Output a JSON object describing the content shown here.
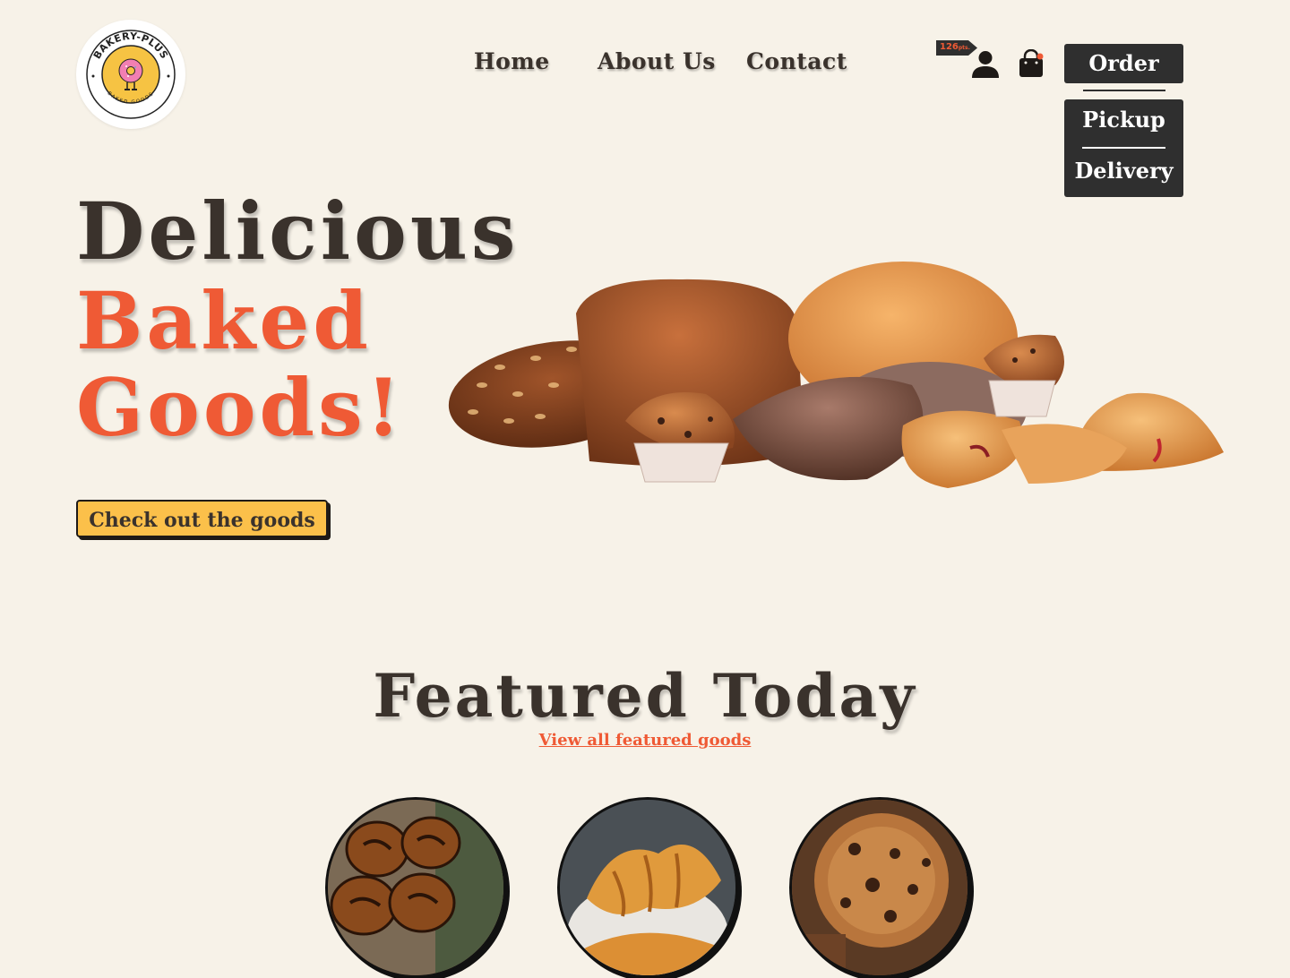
{
  "brand": {
    "name": "BAKERY-PLUS",
    "tagline": "BAKED GOODS",
    "logo_colors": {
      "ring": "#222222",
      "donut": "#f6c343",
      "frosting": "#f27fb2"
    }
  },
  "nav": {
    "items": [
      {
        "label": "Home"
      },
      {
        "label": "About Us"
      },
      {
        "label": "Contact"
      }
    ]
  },
  "account": {
    "points_value": "126",
    "points_unit": "pts.",
    "cart_has_items": true
  },
  "order": {
    "button_label": "Order",
    "menu": [
      {
        "label": "Pickup"
      },
      {
        "label": "Delivery"
      }
    ]
  },
  "hero": {
    "line1": "Delicious",
    "line2": "Baked",
    "line3": "Goods!",
    "cta_label": "Check out the goods"
  },
  "featured": {
    "title": "Featured Today",
    "link_label": "View all featured goods",
    "items": [
      {
        "image": "cinnamon-rolls"
      },
      {
        "image": "croissants"
      },
      {
        "image": "chocolate-chip-cookies"
      }
    ]
  },
  "colors": {
    "background": "#f7f2e8",
    "text": "#3a322c",
    "accent": "#ef5a35",
    "cta": "#fbc04a",
    "dark": "#2f2f2f"
  }
}
